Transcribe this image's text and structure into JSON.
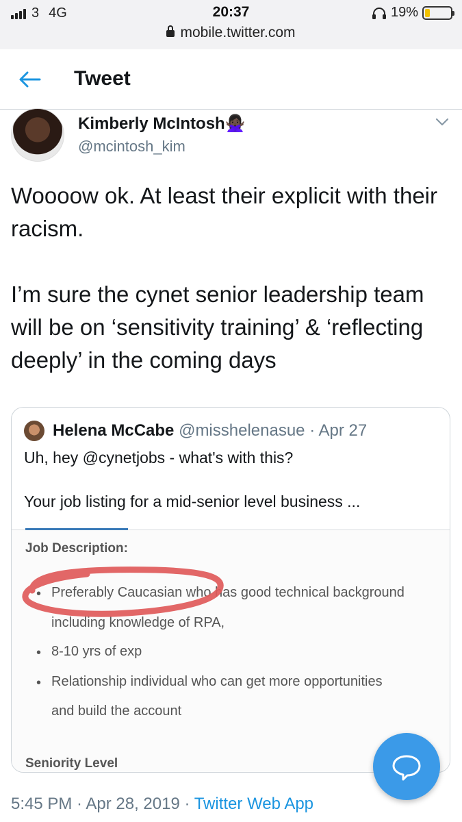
{
  "status_bar": {
    "carrier": "3",
    "network": "4G",
    "time": "20:37",
    "battery": "19%",
    "battery_level": 0.19,
    "url": "mobile.twitter.com"
  },
  "header": {
    "title": "Tweet"
  },
  "tweet": {
    "author_name": "Kimberly McIntosh",
    "author_emoji": "🙅🏿‍♀️",
    "author_handle": "@mcintosh_kim",
    "text": "Woooow ok. At least their explicit with their racism.\n\nI’m sure the cynet senior leadership team will be on ‘sensitivity training’ & ‘reflecting deeply’ in the coming days",
    "timestamp": "5:45 PM · Apr 28, 2019 · ",
    "source": "Twitter Web App"
  },
  "quoted_tweet": {
    "author_name": "Helena McCabe",
    "author_handle": "@misshelenasue",
    "date": " · Apr 27",
    "line1": "Uh, hey @cynetjobs - what's with this?",
    "line2": "Your job listing for a mid-senior level business ...",
    "image": {
      "heading": "Job Description:",
      "bullets": [
        "Preferably Caucasian who has good technical background",
        "including knowledge of RPA,",
        "8-10 yrs of exp",
        "Relationship individual who can get more opportunities",
        "and build the account"
      ],
      "cutoff_text": "Seniority Level"
    }
  },
  "colors": {
    "accent": "#1b95e0",
    "fab": "#3b9ae8",
    "circle_annotation": "#e05a5a"
  },
  "icons": {
    "back": "arrow-left-icon",
    "menu": "chevron-down-icon",
    "fab": "reply-bubble-icon"
  }
}
